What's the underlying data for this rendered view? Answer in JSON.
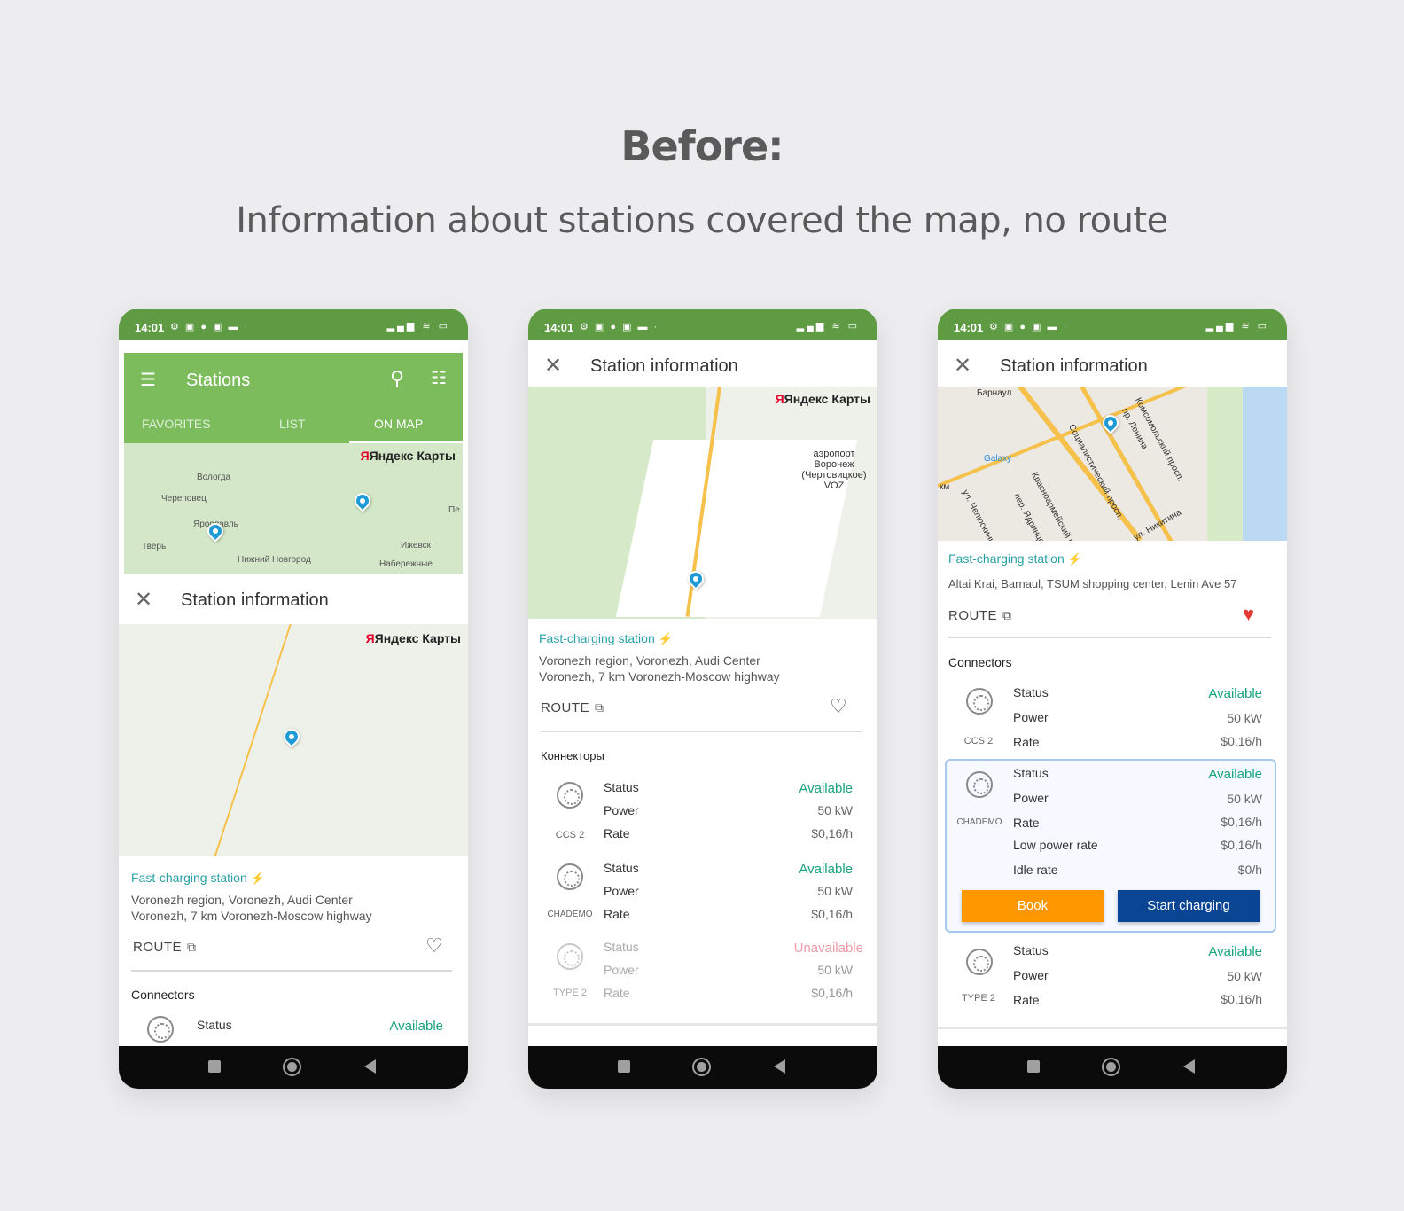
{
  "headline": "Before:",
  "subheadline": "Information about stations covered the map, no route",
  "status_bar": {
    "time": "14:01",
    "left_icons": "⚙ ▣ ● ▣ ▬ ·",
    "right_icons": "▂▄▆ ≋ ▭"
  },
  "phone1": {
    "appbar_title": "Stations",
    "tabs": [
      "FAVORITES",
      "LIST",
      "ON MAP"
    ],
    "map_brand": "Яндекс Карты",
    "map_labels": [
      "Вологда",
      "Череповец",
      "Ярославль",
      "Тверь",
      "Нижний Новгород",
      "Ижевск",
      "Набережные",
      "Пе"
    ],
    "sheet_title": "Station information",
    "map_brand_2": "Яндекс Карты",
    "station_type": "Fast-charging station",
    "address_line1": "Voronezh region, Voronezh, Audi Center",
    "address_line2": "Voronezh, 7 km Voronezh-Moscow highway",
    "route_label": "ROUTE",
    "connectors_title": "Connectors",
    "first_row_key": "Status",
    "first_row_value": "Available"
  },
  "phone2": {
    "sheet_title": "Station information",
    "map_brand": "Яндекс Карты",
    "map_label": "аэропорт Воронеж (Чертовицкое) VOZ",
    "station_type": "Fast-charging station",
    "address_line1": "Voronezh region, Voronezh, Audi Center",
    "address_line2": "Voronezh, 7 km Voronezh-Moscow highway",
    "route_label": "ROUTE",
    "connectors_title": "Коннекторы",
    "connectors": [
      {
        "name": "CCS 2",
        "rows": [
          [
            "Status",
            "Available"
          ],
          [
            "Power",
            "50 kW"
          ],
          [
            "Rate",
            "$0,16/h"
          ]
        ]
      },
      {
        "name": "CHADEMO",
        "rows": [
          [
            "Status",
            "Available"
          ],
          [
            "Power",
            "50 kW"
          ],
          [
            "Rate",
            "$0,16/h"
          ]
        ]
      },
      {
        "name": "TYPE 2",
        "rows": [
          [
            "Status",
            "Unavailable"
          ],
          [
            "Power",
            "50 kW"
          ],
          [
            "Rate",
            "$0,16/h"
          ]
        ]
      }
    ]
  },
  "phone3": {
    "sheet_title": "Station information",
    "map_labels": [
      "Барнаул",
      "Galaxy",
      "Красноармейский просп.",
      "Социалистический просп.",
      "пр. Ленина",
      "Комсомольский просп.",
      "пер. Ядринцева",
      "ул. Челюскинцев",
      "ул. Никитина",
      "км"
    ],
    "station_type": "Fast-charging station",
    "address": "Altai Krai, Barnaul, TSUM shopping center, Lenin Ave 57",
    "route_label": "ROUTE",
    "connectors_title": "Connectors",
    "connectors": [
      {
        "name": "CCS 2",
        "rows": [
          [
            "Status",
            "Available"
          ],
          [
            "Power",
            "50 kW"
          ],
          [
            "Rate",
            "$0,16/h"
          ]
        ]
      },
      {
        "name": "CHADEMO",
        "rows": [
          [
            "Status",
            "Available"
          ],
          [
            "Power",
            "50 kW"
          ],
          [
            "Rate",
            "$0,16/h"
          ],
          [
            "Low power rate",
            "$0,16/h"
          ],
          [
            "Idle rate",
            "$0/h"
          ]
        ]
      },
      {
        "name": "TYPE 2",
        "rows": [
          [
            "Status",
            "Available"
          ],
          [
            "Power",
            "50 kW"
          ],
          [
            "Rate",
            "$0,16/h"
          ]
        ]
      }
    ],
    "book_label": "Book",
    "start_label": "Start charging"
  },
  "colors": {
    "status_green": "#5e9b43",
    "appbar_green": "#7cbc5d",
    "available": "#17a37a",
    "unavailable": "#f29aa8",
    "book": "#ff9800",
    "start": "#0a4594",
    "teal_label": "#2ba0a8"
  }
}
